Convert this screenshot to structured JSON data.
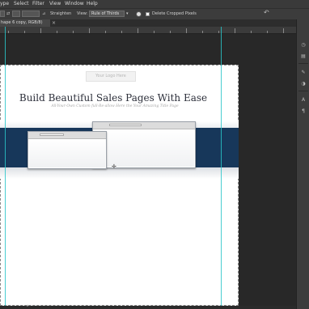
{
  "menu": {
    "items": [
      "ype",
      "Select",
      "Filter",
      "View",
      "Window",
      "Help"
    ]
  },
  "options": {
    "straighten_label": "Straighten",
    "view_label": "View:",
    "view_value": "Rule of Thirds",
    "delete_cropped": "Delete Cropped Pixels",
    "undo_icon": "undo-arrow-icon"
  },
  "tab": {
    "title": "hape 6 copy, RGB/8)",
    "close": "×"
  },
  "canvas": {
    "logo_placeholder": "Your Logo Here",
    "headline": "Build Beautiful Sales Pages With Ease",
    "subhead": "All-Your-Own Custom full-Re-allow Here the Your Amazing Title Page"
  },
  "colors": {
    "guide": "#29c6c9",
    "banner": "#17375a",
    "workspace": "#282828"
  }
}
